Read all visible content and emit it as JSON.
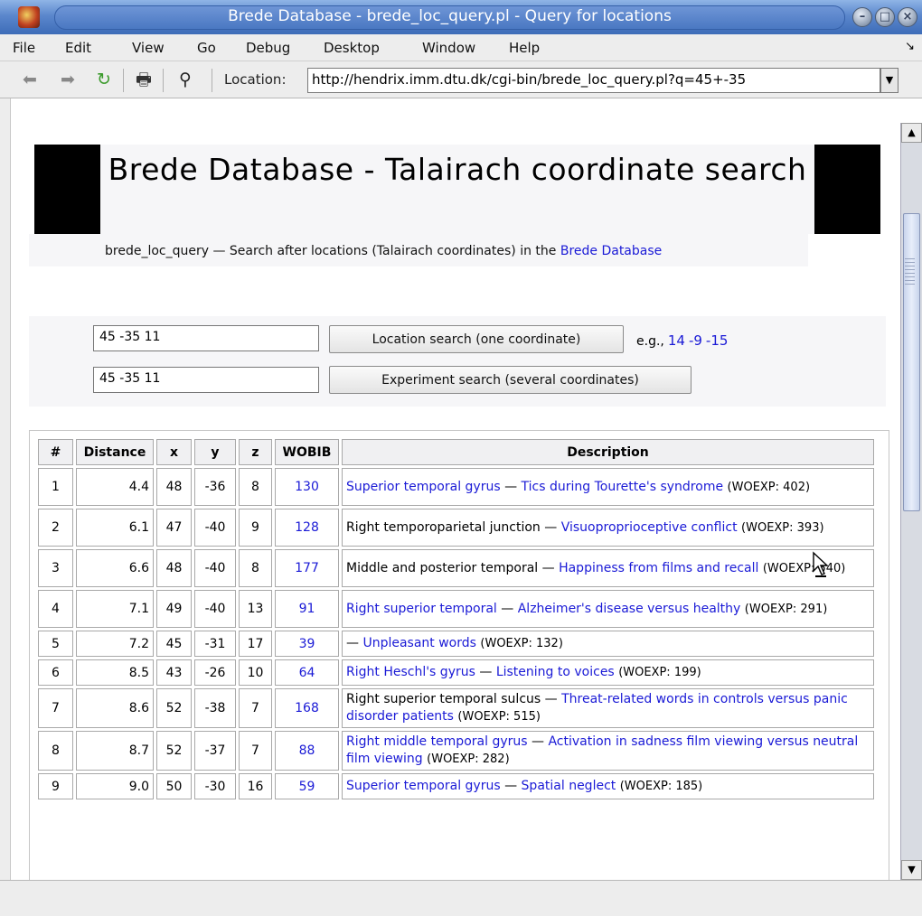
{
  "window": {
    "title": "Brede Database - brede_loc_query.pl - Query for locations"
  },
  "menu": [
    "File",
    "Edit",
    "View",
    "Go",
    "Debug",
    "Desktop",
    "Window",
    "Help"
  ],
  "toolbar": {
    "location_label": "Location:",
    "url": "http://hendrix.imm.dtu.dk/cgi-bin/brede_loc_query.pl?q=45+-35",
    "icons": [
      "back-icon",
      "forward-icon",
      "reload-icon",
      "print-icon",
      "find-icon"
    ]
  },
  "page": {
    "title": "Brede Database - Talairach coordinate search",
    "subtitle_prefix": "brede_loc_query — Search after locations (Talairach coordinates) in the ",
    "subtitle_link": "Brede Database",
    "location_input": "45 -35 11",
    "location_button": "Location search (one coordinate)",
    "eg_label": "e.g.,",
    "eg_values": [
      "14",
      "-9",
      "-15"
    ],
    "experiment_input": "45 -35 11",
    "experiment_button": "Experiment search (several coordinates)"
  },
  "table": {
    "headers": [
      "#",
      "Distance",
      "x",
      "y",
      "z",
      "WOBIB",
      "Description"
    ],
    "rows": [
      {
        "n": "1",
        "distance": "4.4",
        "x": "48",
        "y": "-36",
        "z": "8",
        "wobib": "130",
        "region": "Superior temporal gyrus",
        "region_link": true,
        "sep": " — ",
        "experiment": "Tics during Tourette's syndrome",
        "woexp": "(WOEXP: 402)"
      },
      {
        "n": "2",
        "distance": "6.1",
        "x": "47",
        "y": "-40",
        "z": "9",
        "wobib": "128",
        "region": "Right temporoparietal junction",
        "region_link": false,
        "sep": " — ",
        "experiment": "Visuoproprioceptive conflict",
        "woexp": "(WOEXP: 393)"
      },
      {
        "n": "3",
        "distance": "6.6",
        "x": "48",
        "y": "-40",
        "z": "8",
        "wobib": "177",
        "region": "Middle and posterior temporal",
        "region_link": false,
        "sep": " — ",
        "experiment": "Happiness from films and recall",
        "woexp": "(WOEXP: 540)"
      },
      {
        "n": "4",
        "distance": "7.1",
        "x": "49",
        "y": "-40",
        "z": "13",
        "wobib": "91",
        "region": "Right superior temporal",
        "region_link": true,
        "sep": " — ",
        "experiment": "Alzheimer's disease versus healthy",
        "woexp": "(WOEXP: 291)"
      },
      {
        "n": "5",
        "distance": "7.2",
        "x": "45",
        "y": "-31",
        "z": "17",
        "wobib": "39",
        "region": "",
        "region_link": false,
        "sep": "— ",
        "experiment": "Unpleasant words",
        "woexp": "(WOEXP: 132)"
      },
      {
        "n": "6",
        "distance": "8.5",
        "x": "43",
        "y": "-26",
        "z": "10",
        "wobib": "64",
        "region": "Right Heschl's gyrus",
        "region_link": true,
        "sep": " — ",
        "experiment": "Listening to voices",
        "woexp": "(WOEXP: 199)"
      },
      {
        "n": "7",
        "distance": "8.6",
        "x": "52",
        "y": "-38",
        "z": "7",
        "wobib": "168",
        "region": "Right superior temporal sulcus",
        "region_link": false,
        "sep": " — ",
        "experiment": "Threat-related words in controls versus panic disorder patients",
        "woexp": "(WOEXP: 515)"
      },
      {
        "n": "8",
        "distance": "8.7",
        "x": "52",
        "y": "-37",
        "z": "7",
        "wobib": "88",
        "region": "Right middle temporal gyrus",
        "region_link": true,
        "sep": " — ",
        "experiment": "Activation in sadness film viewing versus neutral film viewing",
        "woexp": "(WOEXP: 282)"
      },
      {
        "n": "9",
        "distance": "9.0",
        "x": "50",
        "y": "-30",
        "z": "16",
        "wobib": "59",
        "region": "Superior temporal gyrus",
        "region_link": true,
        "sep": " — ",
        "experiment": "Spatial neglect",
        "woexp": "(WOEXP: 185)"
      }
    ]
  },
  "colors": {
    "link": "#1a1ad6",
    "titlebar": "#5b87cc"
  }
}
